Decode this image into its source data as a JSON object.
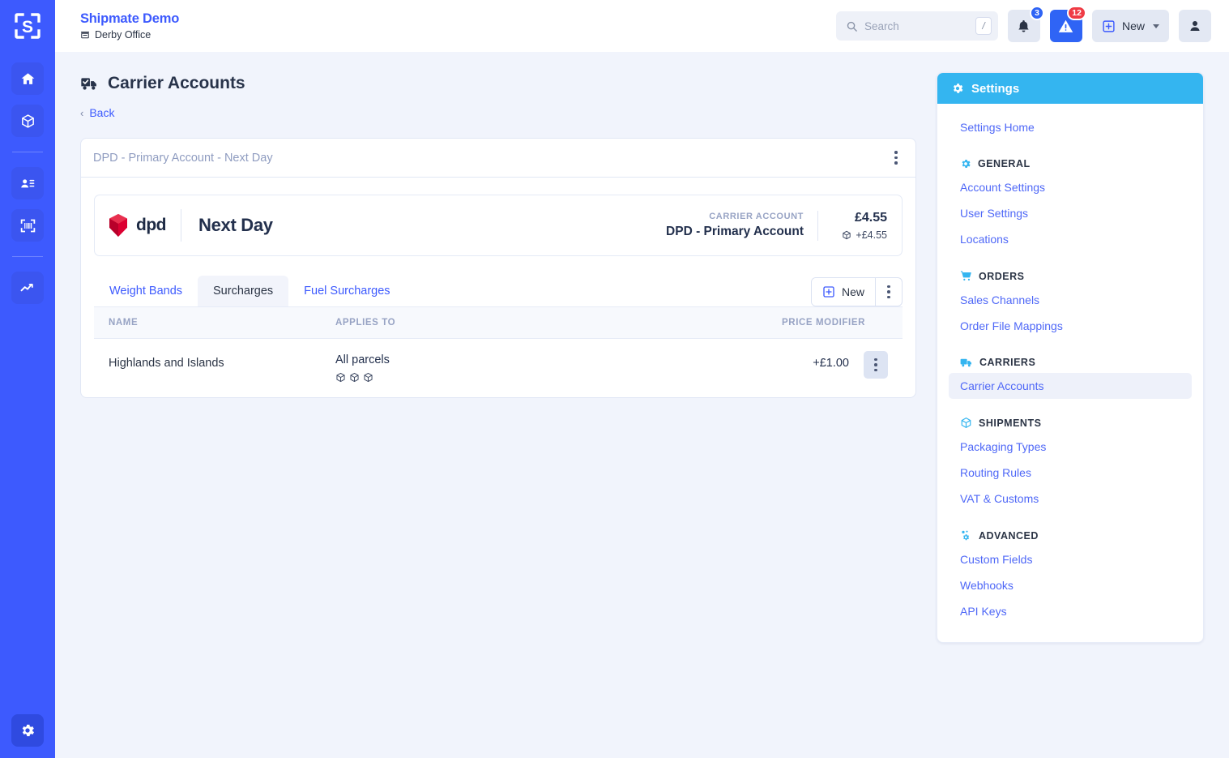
{
  "sidebar": {
    "logo": "shipmate-logo",
    "items": [
      {
        "icon": "home-icon",
        "name": "home"
      },
      {
        "icon": "package-icon",
        "name": "shipments"
      },
      {
        "icon": "address-card-icon",
        "name": "contacts"
      },
      {
        "icon": "barcode-scan-icon",
        "name": "scan"
      },
      {
        "icon": "analytics-line-icon",
        "name": "analytics"
      }
    ],
    "bottom": {
      "icon": "gear-icon",
      "name": "settings"
    }
  },
  "header": {
    "brand_title": "Shipmate Demo",
    "brand_sub": "Derby Office",
    "brand_sub_icon": "office-building-icon",
    "search": {
      "placeholder": "Search",
      "value": "",
      "icon": "search-icon",
      "shortcut": "/"
    },
    "notifications": {
      "icon": "bell-icon",
      "badge": "3"
    },
    "alerts": {
      "icon": "warning-triangle-icon",
      "badge": "12"
    },
    "new_button": {
      "label": "New",
      "icon": "plus-square-icon",
      "caret": "chevron-down-icon"
    },
    "account": {
      "icon": "user-icon"
    }
  },
  "page": {
    "title": "Carrier Accounts",
    "title_icon": "truck-check-icon",
    "back_label": "Back",
    "back_icon": "chevron-left-icon"
  },
  "card": {
    "header_title": "DPD - Primary Account - Next Day",
    "menu_icon": "kebab-menu-icon",
    "service": {
      "carrier_logo": "dpd-logo",
      "carrier_logo_text": "dpd",
      "service_name": "Next Day",
      "account_label": "CARRIER ACCOUNT",
      "account_value": "DPD - Primary Account",
      "price_main": "£4.55",
      "price_sub": "+£4.55",
      "price_sub_icon": "package-icon"
    },
    "tabs": [
      {
        "label": "Weight Bands",
        "active": false
      },
      {
        "label": "Surcharges",
        "active": true
      },
      {
        "label": "Fuel Surcharges",
        "active": false
      }
    ],
    "actions": {
      "new_label": "New",
      "new_icon": "plus-square-icon",
      "menu_icon": "kebab-menu-icon"
    },
    "table": {
      "columns": [
        "NAME",
        "APPLIES TO",
        "PRICE MODIFIER"
      ],
      "rows": [
        {
          "name": "Highlands and Islands",
          "applies_to": "All parcels",
          "applies_icons": [
            "package-icon",
            "package-icon",
            "package-icon"
          ],
          "price_modifier": "+£1.00",
          "menu_icon": "kebab-menu-icon"
        }
      ]
    }
  },
  "settings_panel": {
    "title": "Settings",
    "title_icon": "gear-icon",
    "home_label": "Settings Home",
    "groups": [
      {
        "label": "GENERAL",
        "icon": "gear-icon",
        "items": [
          {
            "label": "Account Settings",
            "active": false
          },
          {
            "label": "User Settings",
            "active": false
          },
          {
            "label": "Locations",
            "active": false
          }
        ]
      },
      {
        "label": "ORDERS",
        "icon": "cart-icon",
        "items": [
          {
            "label": "Sales Channels",
            "active": false
          },
          {
            "label": "Order File Mappings",
            "active": false
          }
        ]
      },
      {
        "label": "CARRIERS",
        "icon": "truck-icon",
        "items": [
          {
            "label": "Carrier Accounts",
            "active": true
          }
        ]
      },
      {
        "label": "SHIPMENTS",
        "icon": "package-icon",
        "items": [
          {
            "label": "Packaging Types",
            "active": false
          },
          {
            "label": "Routing Rules",
            "active": false
          },
          {
            "label": "VAT & Customs",
            "active": false
          }
        ]
      },
      {
        "label": "ADVANCED",
        "icon": "advanced-gears-icon",
        "items": [
          {
            "label": "Custom Fields",
            "active": false
          },
          {
            "label": "Webhooks",
            "active": false
          },
          {
            "label": "API Keys",
            "active": false
          }
        ]
      }
    ]
  },
  "colors": {
    "rail_blue": "#3d5afe",
    "accent_blue": "#3d5afe",
    "settings_header_cyan": "#34b5f0",
    "badge_red": "#ef3b45",
    "badge_blue": "#2f64f5",
    "dpd_red": "#dc0032",
    "page_background": "#f1f4fc"
  }
}
